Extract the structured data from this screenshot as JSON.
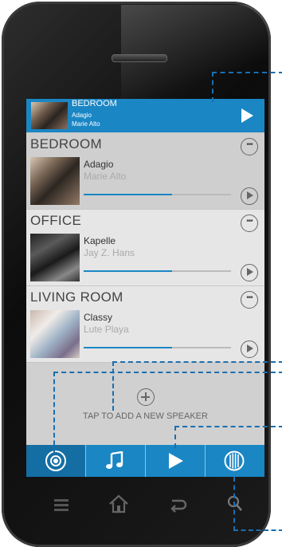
{
  "now_playing": {
    "room": "BEDROOM",
    "song": "Adagio",
    "artist": "Marie Alto"
  },
  "speakers": [
    {
      "room": "BEDROOM",
      "song": "Adagio",
      "artist": "Marie Alto",
      "progress": 0.6
    },
    {
      "room": "OFFICE",
      "song": "Kapelle",
      "artist": "Jay Z. Hans",
      "progress": 0.6
    },
    {
      "room": "LIVING ROOM",
      "song": "Classy",
      "artist": "Lute Playa",
      "progress": 0.6
    }
  ],
  "add_speaker": {
    "label": "TAP TO ADD A NEW SPEAKER"
  },
  "tabs": [
    {
      "name": "speakers",
      "icon": "target-icon",
      "active": true
    },
    {
      "name": "music",
      "icon": "music-note-icon",
      "active": false
    },
    {
      "name": "now-playing",
      "icon": "play-icon",
      "active": false
    },
    {
      "name": "speaker-device",
      "icon": "speaker-grille-icon",
      "active": false
    }
  ],
  "phone_nav": [
    "menu-icon",
    "home-icon",
    "back-icon",
    "search-icon"
  ],
  "colors": {
    "accent": "#1a86c4",
    "accent_dark": "#146ea3",
    "callout": "#1a6fb0"
  }
}
